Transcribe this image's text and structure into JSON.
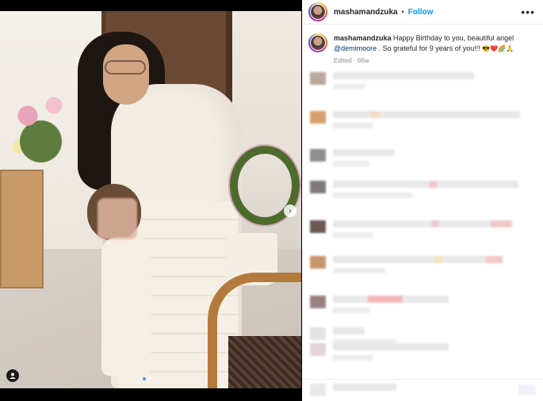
{
  "post": {
    "username": "mashamandzuka",
    "separator": "•",
    "follow_label": "Follow",
    "more_label": "•••",
    "caption": {
      "username": "mashamandzuka",
      "text_part1": "Happy Birthday to you, beautiful angel",
      "mention": "@demimoore",
      "text_part2": ". So grateful for 9 years of you!!!",
      "emojis": "😎❤️🌈🙏",
      "edited_label": "Edited",
      "age_label": "66w"
    }
  },
  "colors": {
    "accent": "#0095f6",
    "mention": "#00376b",
    "meta": "#8e8e8e"
  },
  "photo": {
    "carousel_count": 2,
    "carousel_active": 1
  }
}
